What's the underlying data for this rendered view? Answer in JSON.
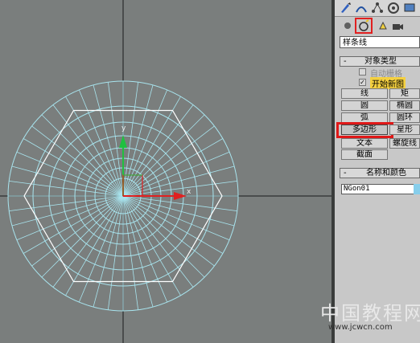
{
  "viewport": {
    "mesh_color": "#a8e4ee",
    "outline_color": "#ffffff",
    "background": "#7a7e7d",
    "axis_x_label": "x",
    "axis_y_label": "y"
  },
  "command_panel": {
    "tabs": [
      "create-tab",
      "modify-tab",
      "hierarchy-tab",
      "motion-tab",
      "display-tab"
    ],
    "sub_icons": [
      "geometry-icon",
      "shapes-icon",
      "lights-icon",
      "cameras-icon"
    ],
    "category_dropdown": "样条线",
    "object_type": {
      "title": "对象类型",
      "auto_grid_label": "自动栅格",
      "start_new_shape_label": "开始新图",
      "buttons": [
        "线",
        "矩",
        "圆",
        "椭圆",
        "弧",
        "圆环",
        "多边形",
        "星形",
        "文本",
        "螺旋线",
        "截面"
      ]
    },
    "name_color": {
      "title": "名称和颜色",
      "name_value": "NGon01",
      "color": "#87ceeb"
    },
    "minus_sign": "-",
    "check_mark": "✓"
  },
  "watermark": {
    "line1": "中国教程网",
    "line2": "www.jcwcn.com"
  }
}
